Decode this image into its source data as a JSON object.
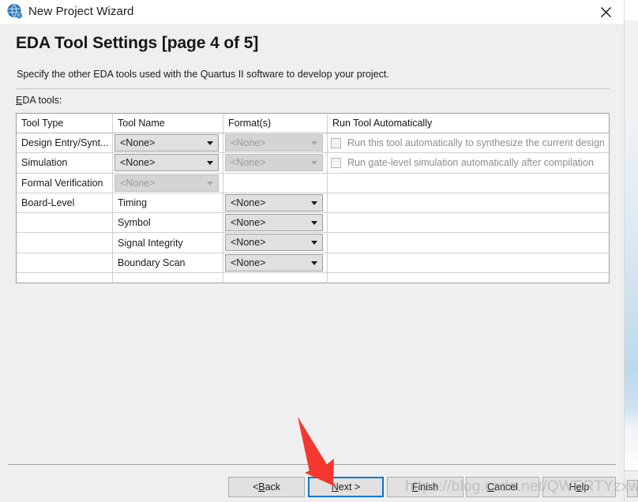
{
  "window": {
    "title": "New Project Wizard",
    "icon": "quartus-globe-icon",
    "close_label": "✕"
  },
  "header": {
    "page_title": "EDA Tool Settings [page 4 of 5]",
    "description": "Specify the other EDA tools used with the Quartus II software to develop your project.",
    "section_label_mnemonic": "E",
    "section_label_rest": "DA tools:"
  },
  "table": {
    "columns": [
      {
        "key": "tool_type",
        "label": "Tool Type"
      },
      {
        "key": "tool_name",
        "label": "Tool Name"
      },
      {
        "key": "formats",
        "label": "Format(s)"
      },
      {
        "key": "run_auto",
        "label": "Run Tool Automatically"
      }
    ],
    "rows": [
      {
        "tool_type": "Design Entry/Synt...",
        "tool_name_combo": {
          "value": "<None>",
          "disabled": false
        },
        "formats_combo": {
          "value": "<None>",
          "disabled": true
        },
        "checkbox": {
          "label": "Run this tool automatically to synthesize the current design",
          "checked": false
        }
      },
      {
        "tool_type": "Simulation",
        "tool_name_combo": {
          "value": "<None>",
          "disabled": false
        },
        "formats_combo": {
          "value": "<None>",
          "disabled": true
        },
        "checkbox": {
          "label": "Run gate-level simulation automatically after compilation",
          "checked": false
        }
      },
      {
        "tool_type": "Formal Verification",
        "tool_name_combo": {
          "value": "<None>",
          "disabled": true
        },
        "formats_combo": null,
        "checkbox": null
      },
      {
        "tool_type": "Board-Level",
        "tool_name_text": "Timing",
        "formats_combo": {
          "value": "<None>",
          "disabled": false
        },
        "checkbox": null
      },
      {
        "tool_type": "",
        "tool_name_text": "Symbol",
        "formats_combo": {
          "value": "<None>",
          "disabled": false
        },
        "checkbox": null
      },
      {
        "tool_type": "",
        "tool_name_text": "Signal Integrity",
        "formats_combo": {
          "value": "<None>",
          "disabled": false
        },
        "checkbox": null
      },
      {
        "tool_type": "",
        "tool_name_text": "Boundary Scan",
        "formats_combo": {
          "value": "<None>",
          "disabled": false
        },
        "checkbox": null
      }
    ]
  },
  "buttons": {
    "back": {
      "pre": "< ",
      "mnemonic": "B",
      "post": "ack",
      "focused": false
    },
    "next": {
      "pre": "",
      "mnemonic": "N",
      "post": "ext >",
      "focused": true
    },
    "finish": {
      "pre": "",
      "mnemonic": "F",
      "post": "inish",
      "focused": false
    },
    "cancel": {
      "pre": "",
      "mnemonic": "C",
      "post": "ancel",
      "focused": false
    },
    "help": {
      "pre": "H",
      "mnemonic": "e",
      "post": "lp",
      "focused": false
    }
  },
  "annotations": {
    "arrow_color": "#f4372f",
    "arrow_target": "next-button"
  },
  "watermark": {
    "text": "https://blog.csdn.net/QWERTYzxw"
  },
  "colors": {
    "dialog_bg": "#efefef",
    "titlebar_bg": "#ffffff",
    "table_bg": "#ffffff",
    "focus_blue": "#0078d7",
    "combo_bg": "#e0e0e0",
    "combo_disabled_bg": "#d4d4d4",
    "disabled_text": "#9b9b9b"
  }
}
